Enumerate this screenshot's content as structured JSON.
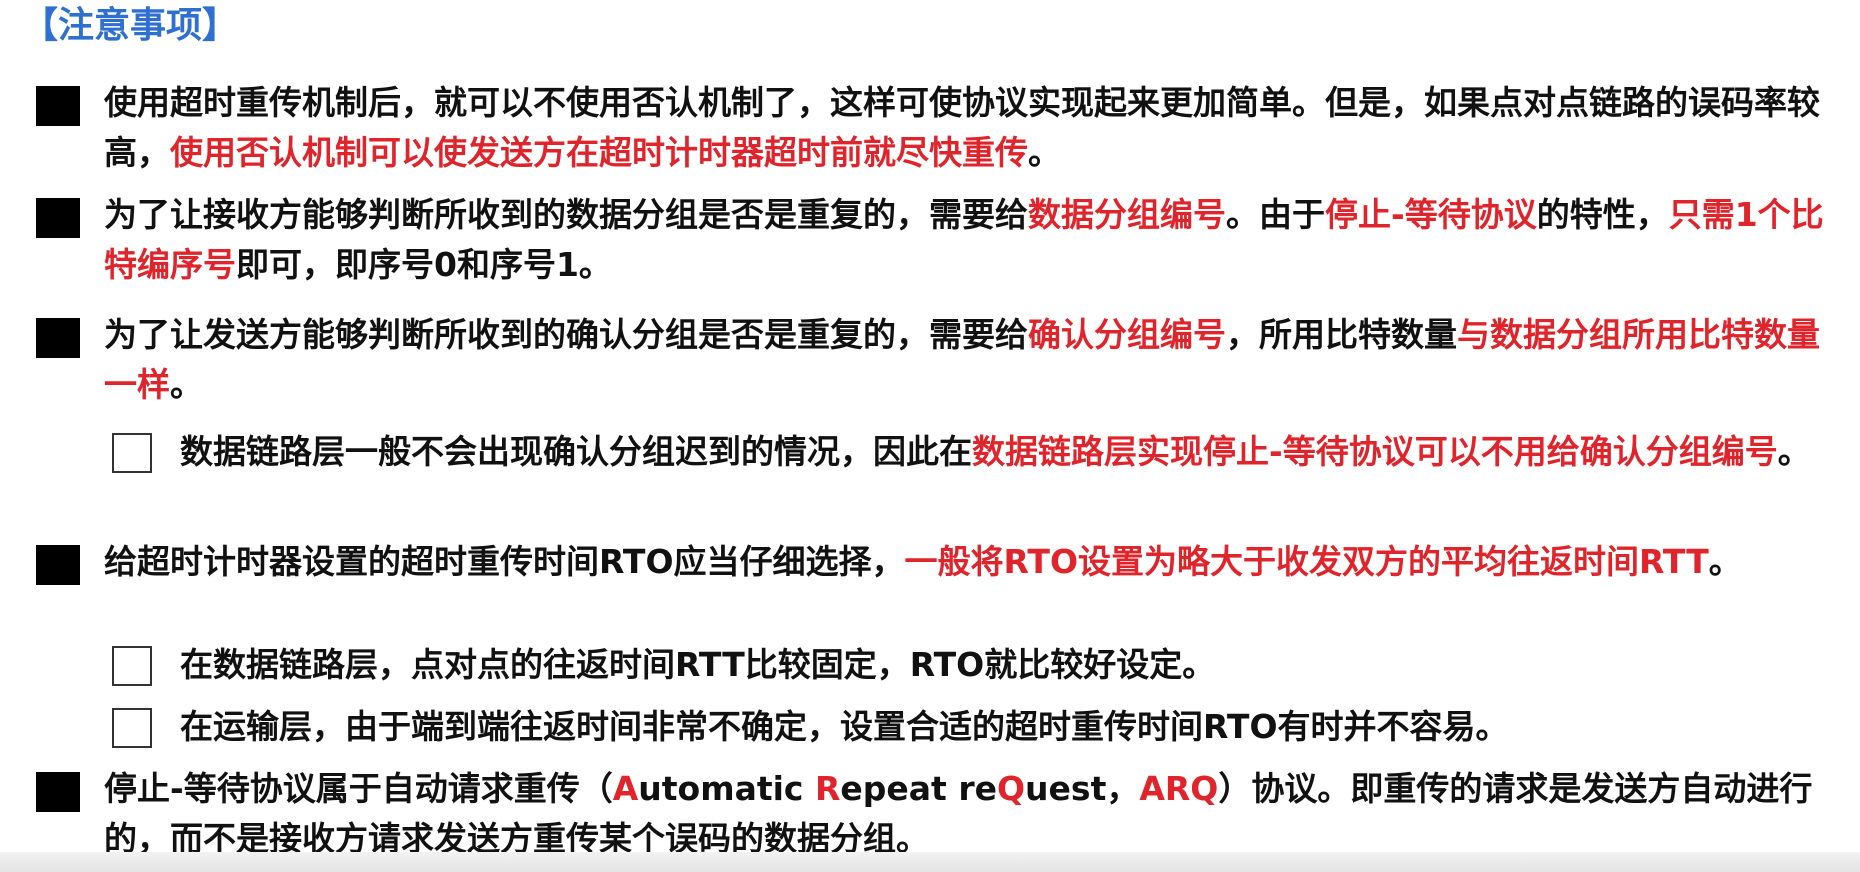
{
  "title": "【注意事项】",
  "items": [
    {
      "level": 1,
      "segments": [
        {
          "text": "使用超时重传机制后，就可以不使用否认机制了，这样可使协议实现起来更加简单。但是，如果点对点链路的误码率较高，",
          "red": false
        },
        {
          "text": "使用否认机制可以使发送方在超时计时器超时前就尽快重传",
          "red": true
        },
        {
          "text": "。",
          "red": false
        }
      ]
    },
    {
      "level": 1,
      "segments": [
        {
          "text": "为了让接收方能够判断所收到的数据分组是否是重复的，需要给",
          "red": false
        },
        {
          "text": "数据分组编号",
          "red": true
        },
        {
          "text": "。由于",
          "red": false
        },
        {
          "text": "停止-等待协议",
          "red": true
        },
        {
          "text": "的特性，",
          "red": false
        },
        {
          "text": "只需1个比特编序号",
          "red": true
        },
        {
          "text": "即可，即序号0和序号1。",
          "red": false
        }
      ]
    },
    {
      "level": 1,
      "segments": [
        {
          "text": "为了让发送方能够判断所收到的确认分组是否是重复的，需要给",
          "red": false
        },
        {
          "text": "确认分组编号",
          "red": true
        },
        {
          "text": "，所用比特数量",
          "red": false
        },
        {
          "text": "与数据分组所用比特数量一样",
          "red": true
        },
        {
          "text": "。",
          "red": false
        }
      ]
    },
    {
      "level": 2,
      "segments": [
        {
          "text": "数据链路层一般不会出现确认分组迟到的情况，因此在",
          "red": false
        },
        {
          "text": "数据链路层实现停止-等待协议可以不用给确认分组编号",
          "red": true
        },
        {
          "text": "。",
          "red": false
        }
      ]
    },
    {
      "level": 1,
      "segments": [
        {
          "text": "给超时计时器设置的超时重传时间RTO应当仔细选择，",
          "red": false
        },
        {
          "text": "一般将RTO设置为略大于收发双方的平均往返时间RTT",
          "red": true
        },
        {
          "text": "。",
          "red": false
        }
      ]
    },
    {
      "level": 2,
      "segments": [
        {
          "text": "在数据链路层，点对点的往返时间RTT比较固定，RTO就比较好设定。",
          "red": false
        }
      ]
    },
    {
      "level": 2,
      "segments": [
        {
          "text": "在运输层，由于端到端往返时间非常不确定，设置合适的超时重传时间RTO有时并不容易。",
          "red": false
        }
      ]
    },
    {
      "level": 1,
      "segments": [
        {
          "text": "停止-等待协议属于自动请求重传（",
          "red": false
        },
        {
          "text": "A",
          "red": true
        },
        {
          "text": "utomatic ",
          "red": false
        },
        {
          "text": "R",
          "red": true
        },
        {
          "text": "epeat re",
          "red": false
        },
        {
          "text": "Q",
          "red": true
        },
        {
          "text": "uest，",
          "red": false
        },
        {
          "text": "ARQ",
          "red": true
        },
        {
          "text": "）协议。即重传的请求是发送方自动进行的，而不是接收方请求发送方重传某个误码的数据分组。",
          "red": false
        }
      ]
    }
  ],
  "colors": {
    "title": "#2f6fd0",
    "highlight": "#e0242b",
    "text": "#111111"
  }
}
